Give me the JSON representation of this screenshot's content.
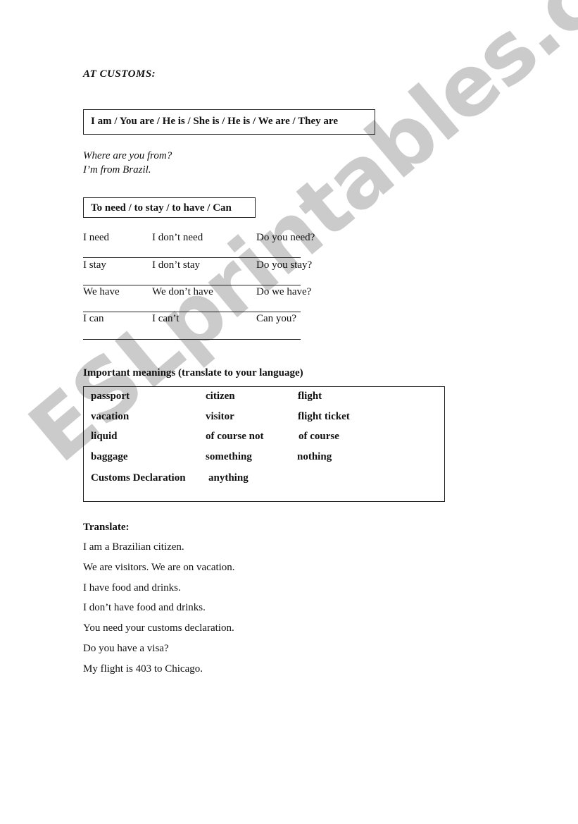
{
  "title": "AT CUSTOMS:",
  "pronouns_box": "I am / You are / He is / She is / He is / We are / They are",
  "dialogue": [
    "Where are you from?",
    "I’m from Brazil."
  ],
  "verbs_box": "To need / to stay / to have / Can",
  "verb_rows": [
    [
      "I need",
      "I don’t need",
      "Do you need?"
    ],
    [
      "I stay",
      "I don’t stay",
      "Do you stay?"
    ],
    [
      "We have",
      "We don’t have",
      "Do we have?"
    ],
    [
      "I can",
      "I can’t",
      "Can you?"
    ]
  ],
  "meanings_heading": "Important meanings (translate to your language)",
  "meanings_rows": [
    [
      "passport",
      "citizen",
      "flight"
    ],
    [
      "vacation",
      "visitor",
      "flight ticket"
    ],
    [
      "liquid",
      "of course not",
      "of course"
    ],
    [
      "baggage",
      "something",
      "nothing"
    ],
    [
      "Customs Declaration",
      "anything",
      ""
    ]
  ],
  "translate_heading": "Translate:",
  "translate_sentences": [
    "I am a Brazilian citizen.",
    "We are visitors. We are on vacation.",
    "I have food and drinks.",
    "I don’t have food and drinks.",
    "You need your customs declaration.",
    "Do you have a visa?",
    "My flight is 403 to Chicago."
  ],
  "watermark": "ESLprintables.com",
  "colors": {
    "watermark": "#c9c9c9",
    "text": "#111111"
  }
}
